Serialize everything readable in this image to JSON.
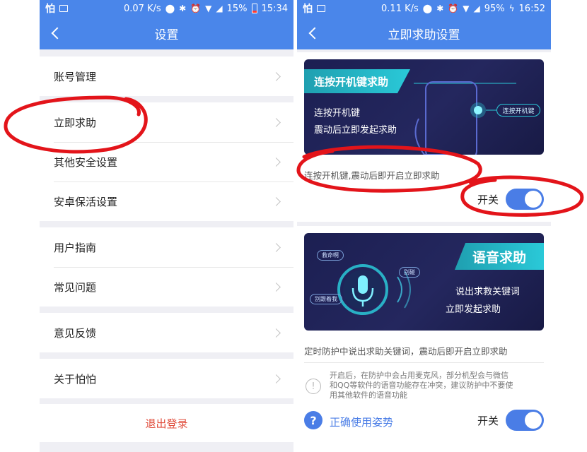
{
  "left": {
    "status": {
      "app": "怕",
      "speed": "0.07 K/s",
      "battery": "15%",
      "time": "15:34"
    },
    "title": "设置",
    "groups": [
      [
        "账号管理"
      ],
      [
        "立即求助",
        "其他安全设置",
        "安卓保活设置"
      ],
      [
        "用户指南",
        "常见问题"
      ],
      [
        "意见反馈"
      ],
      [
        "关于怕怕"
      ]
    ],
    "logout": "退出登录"
  },
  "right": {
    "status": {
      "app": "怕",
      "speed": "0.11 K/s",
      "battery": "95%",
      "time": "16:52"
    },
    "title": "立即求助设置",
    "power": {
      "banner_title": "连按开机键求助",
      "banner_line1": "连按开机键",
      "banner_line2": "震动后立即发起求助",
      "button_label": "连按开机键",
      "desc": "连按开机键,震动后即开启立即求助",
      "switch_label": "开关"
    },
    "voice": {
      "banner_title": "语音求助",
      "banner_line1": "说出求救关键词",
      "banner_line2": "立即发起求助",
      "bubble1": "救命啊",
      "bubble2": "别跟着我",
      "bubble3": "别碰",
      "desc": "定时防护中说出求助关键词，震动后即开启立即求助",
      "notice_line1": "开启后，在防护中会占用麦克风，部分机型会与微信",
      "notice_line2": "和QQ等软件的语音功能存在冲突，建议防护中不要使",
      "notice_line3": "用其他软件的语音功能",
      "help_link": "正确使用姿势",
      "switch_label": "开关"
    }
  },
  "colors": {
    "accent": "#4a86ea",
    "toggle": "#4a7de6",
    "logout": "#e04b3a",
    "annotation": "#e3141a"
  }
}
